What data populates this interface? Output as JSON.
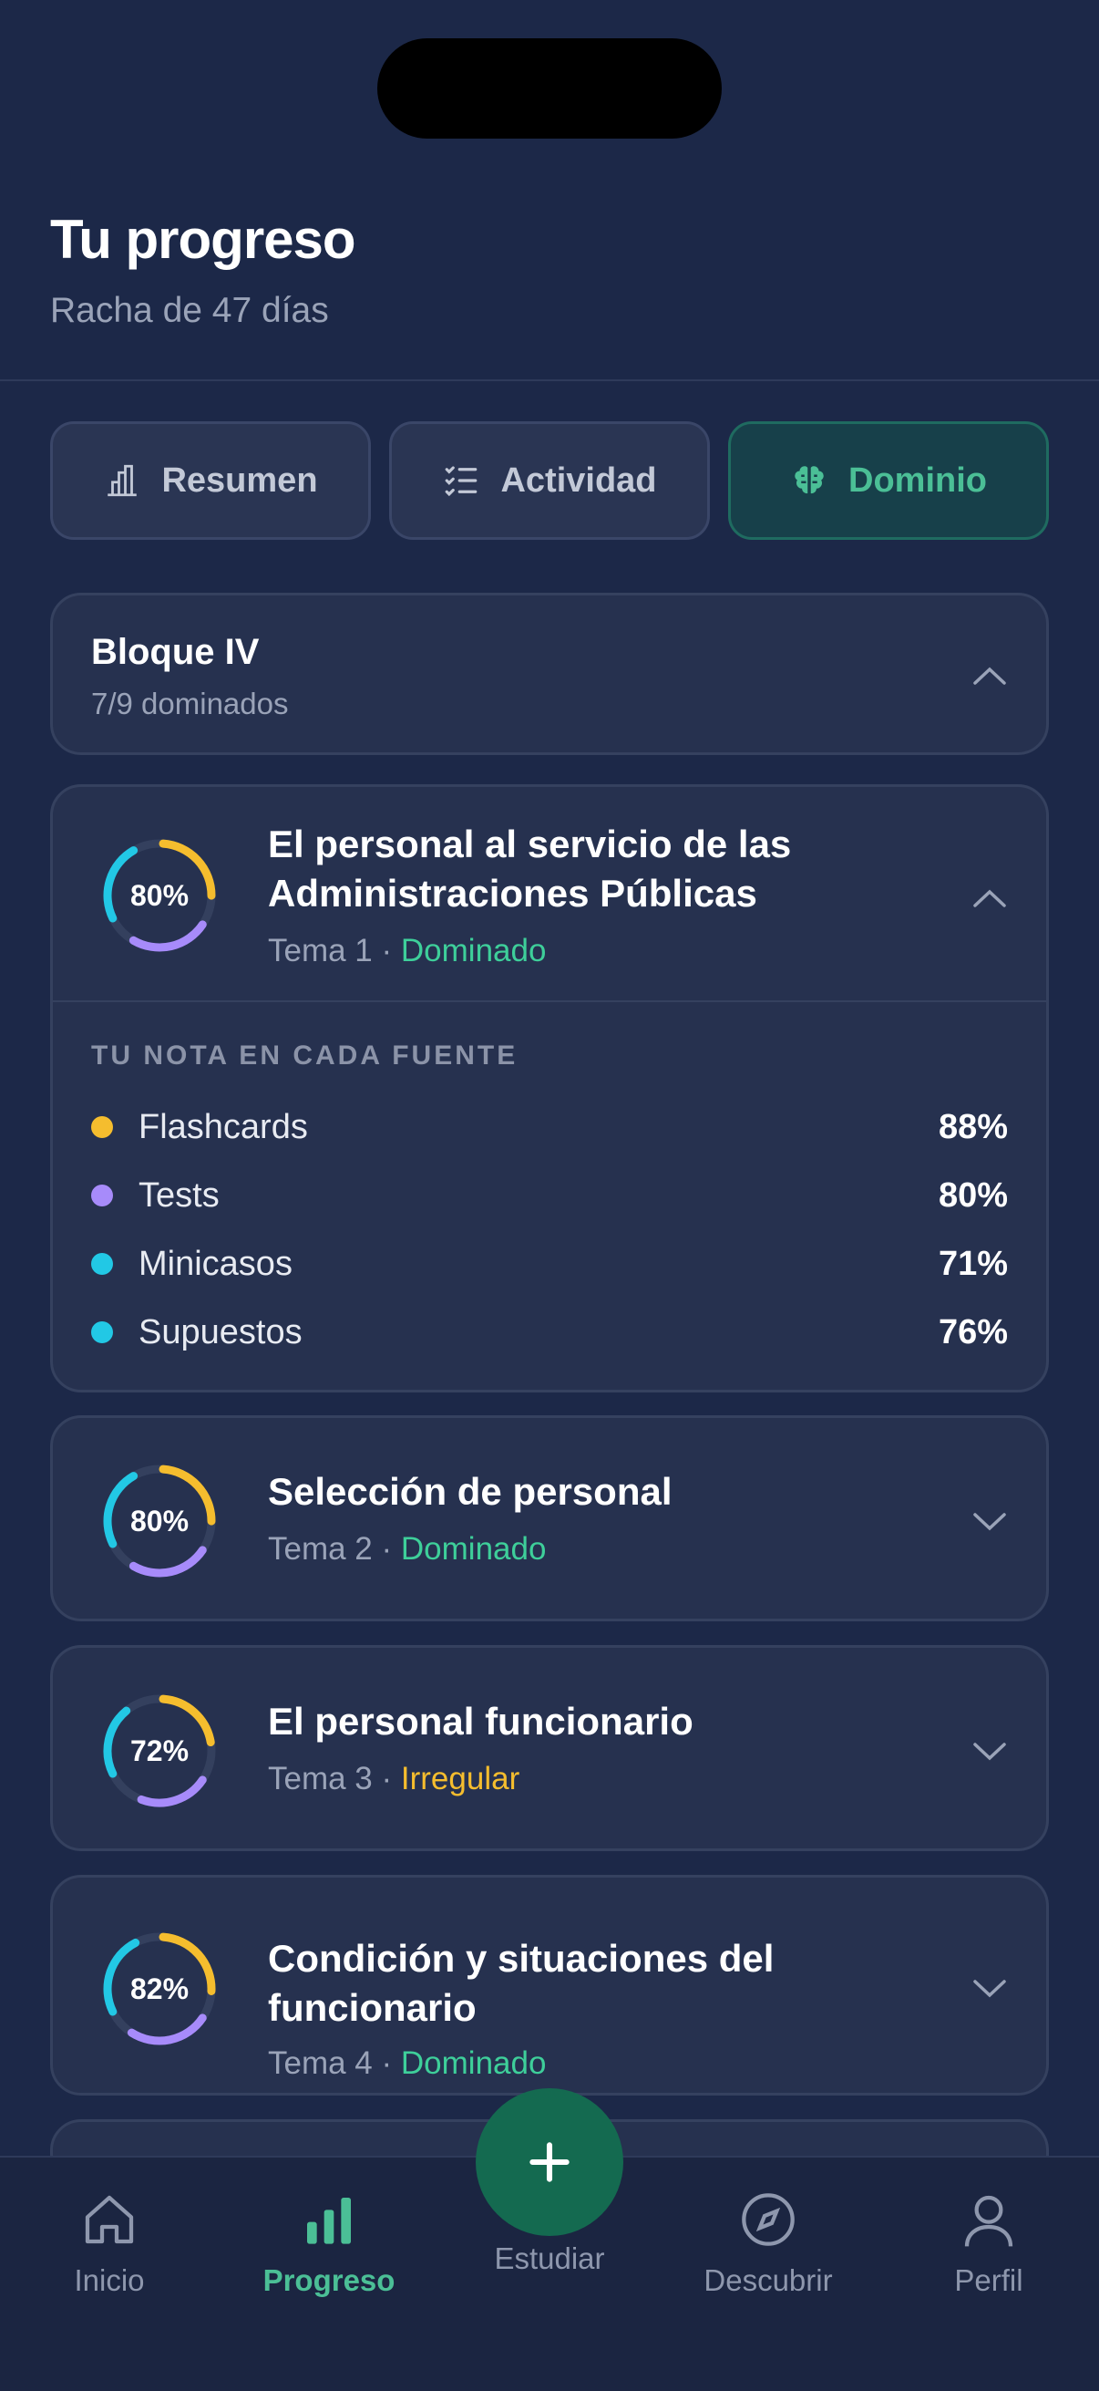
{
  "header": {
    "title": "Tu progreso",
    "subtitle": "Racha de 47 días"
  },
  "tabs": [
    {
      "label": "Resumen",
      "icon": "bar-chart-icon",
      "active": false
    },
    {
      "label": "Actividad",
      "icon": "checklist-icon",
      "active": false
    },
    {
      "label": "Dominio",
      "icon": "brain-icon",
      "active": true
    }
  ],
  "block": {
    "title": "Bloque IV",
    "subtitle": "7/9 dominados"
  },
  "topics": [
    {
      "percent_label": "80%",
      "percent": 80,
      "title": "El personal al servicio de las Administraciones Públicas",
      "tema": "Tema 1 ·",
      "status": "Dominado",
      "expanded": true
    },
    {
      "percent_label": "80%",
      "percent": 80,
      "title": "Selección de personal",
      "tema": "Tema 2 ·",
      "status": "Dominado",
      "expanded": false
    },
    {
      "percent_label": "72%",
      "percent": 72,
      "title": "El personal funcionario",
      "tema": "Tema 3 ·",
      "status": "Irregular",
      "expanded": false
    },
    {
      "percent_label": "82%",
      "percent": 82,
      "title": "Condición y situaciones del funcionario",
      "tema": "Tema 4 ·",
      "status": "Dominado",
      "expanded": false
    }
  ],
  "sources": {
    "heading": "TU NOTA EN CADA FUENTE",
    "items": [
      {
        "name": "Flashcards",
        "value": "88%",
        "color": "#f5bd2e"
      },
      {
        "name": "Tests",
        "value": "80%",
        "color": "#a78bfa"
      },
      {
        "name": "Minicasos",
        "value": "71%",
        "color": "#22c8e5"
      },
      {
        "name": "Supuestos",
        "value": "76%",
        "color": "#22c8e5"
      }
    ]
  },
  "nav": {
    "items": [
      {
        "label": "Inicio",
        "icon": "home-icon"
      },
      {
        "label": "Progreso",
        "icon": "bar-chart-icon",
        "active": true
      },
      {
        "label": "Descubrir",
        "icon": "compass-icon"
      },
      {
        "label": "Perfil",
        "icon": "user-icon"
      }
    ],
    "fab_label": "Estudiar",
    "fab_icon": "plus-icon"
  },
  "colors": {
    "accent": "#4bbf96",
    "good": "#3ecf9a",
    "warn": "#f5bd2e",
    "ring_yellow": "#f5bd2e",
    "ring_purple": "#a78bfa",
    "ring_cyan": "#22c8e5"
  }
}
